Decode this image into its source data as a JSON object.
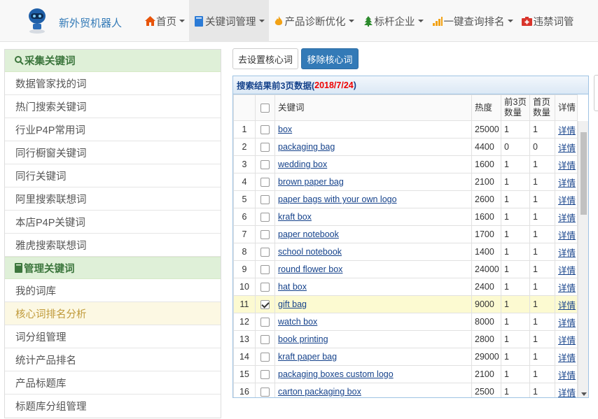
{
  "brand": {
    "name": "新外贸机器人"
  },
  "nav": [
    {
      "label": "首页",
      "icon": "home-icon",
      "color": "#e8540a"
    },
    {
      "label": "关键词管理",
      "icon": "book-icon",
      "color": "#2b7bd6",
      "active": true
    },
    {
      "label": "产品诊断优化",
      "icon": "fire-icon",
      "color": "#f2a216"
    },
    {
      "label": "标杆企业",
      "icon": "tree-icon",
      "color": "#2c8a2c"
    },
    {
      "label": "一键查询排名",
      "icon": "signal-icon",
      "color": "#f2a216"
    },
    {
      "label": "违禁词管",
      "icon": "medkit-icon",
      "color": "#d9342b"
    }
  ],
  "sidebar": {
    "group1": {
      "title": "采集关键词",
      "icon": "search-icon"
    },
    "items1": [
      "数据管家找的词",
      "热门搜索关键词",
      "行业P4P常用词",
      "同行橱窗关键词",
      "同行关键词",
      "阿里搜索联想词",
      "本店P4P关键词",
      "雅虎搜索联想词"
    ],
    "group2": {
      "title": "管理关键词",
      "icon": "book-icon"
    },
    "items2": [
      "我的词库",
      "核心词排名分析",
      "词分组管理",
      "统计产品排名",
      "产品标题库",
      "标题库分组管理"
    ],
    "active_item": "核心词排名分析"
  },
  "buttons": {
    "set_core": "去设置核心词",
    "remove_core": "移除核心词"
  },
  "panel": {
    "title_prefix": "搜索结果前3页数据(",
    "title_date": "2018/7/24",
    "title_suffix": ")"
  },
  "table": {
    "headers": {
      "keyword": "关键词",
      "heat": "热度",
      "top3": "前3页\n数量",
      "first": "首页\n数量",
      "detail": "详情"
    },
    "detail_label": "详情",
    "rows": [
      {
        "no": "1",
        "keyword": "box",
        "heat": "25000",
        "top3": "1",
        "first": "1",
        "checked": false
      },
      {
        "no": "2",
        "keyword": "packaging bag",
        "heat": "4400",
        "top3": "0",
        "first": "0",
        "checked": false
      },
      {
        "no": "3",
        "keyword": "wedding box",
        "heat": "1600",
        "top3": "1",
        "first": "1",
        "checked": false
      },
      {
        "no": "4",
        "keyword": "brown paper bag",
        "heat": "2100",
        "top3": "1",
        "first": "1",
        "checked": false
      },
      {
        "no": "5",
        "keyword": "paper bags with your own logo",
        "heat": "2600",
        "top3": "1",
        "first": "1",
        "checked": false
      },
      {
        "no": "6",
        "keyword": "kraft box",
        "heat": "1600",
        "top3": "1",
        "first": "1",
        "checked": false
      },
      {
        "no": "7",
        "keyword": "paper notebook",
        "heat": "1700",
        "top3": "1",
        "first": "1",
        "checked": false
      },
      {
        "no": "8",
        "keyword": "school notebook",
        "heat": "1400",
        "top3": "1",
        "first": "1",
        "checked": false
      },
      {
        "no": "9",
        "keyword": "round flower box",
        "heat": "24000",
        "top3": "1",
        "first": "1",
        "checked": false
      },
      {
        "no": "10",
        "keyword": "hat box",
        "heat": "2400",
        "top3": "1",
        "first": "1",
        "checked": false
      },
      {
        "no": "11",
        "keyword": "gift bag",
        "heat": "9000",
        "top3": "1",
        "first": "1",
        "checked": true
      },
      {
        "no": "12",
        "keyword": "watch box",
        "heat": "8000",
        "top3": "1",
        "first": "1",
        "checked": false
      },
      {
        "no": "13",
        "keyword": "book printing",
        "heat": "2800",
        "top3": "1",
        "first": "1",
        "checked": false
      },
      {
        "no": "14",
        "keyword": "kraft paper bag",
        "heat": "29000",
        "top3": "1",
        "first": "1",
        "checked": false
      },
      {
        "no": "15",
        "keyword": "packaging boxes custom logo",
        "heat": "2100",
        "top3": "1",
        "first": "1",
        "checked": false
      },
      {
        "no": "16",
        "keyword": "carton packaging box",
        "heat": "2500",
        "top3": "1",
        "first": "1",
        "checked": false
      }
    ]
  }
}
